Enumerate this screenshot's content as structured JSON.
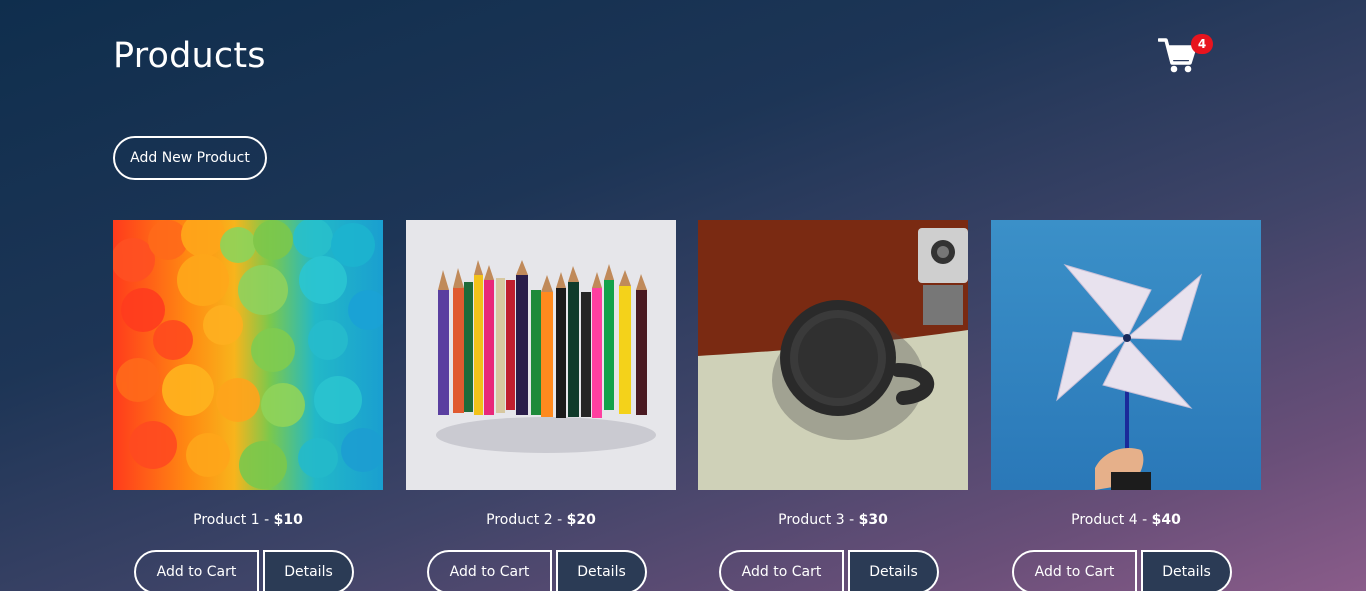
{
  "page": {
    "title": "Products"
  },
  "cart": {
    "icon": "cart-icon",
    "count": "4",
    "badge_color": "#e8141e"
  },
  "toolbar": {
    "add_new_label": "Add New Product"
  },
  "products": [
    {
      "name": "Product 1",
      "separator": " - ",
      "price": "$10",
      "add_to_cart_label": "Add to Cart",
      "details_label": "Details"
    },
    {
      "name": "Product 2",
      "separator": " - ",
      "price": "$20",
      "add_to_cart_label": "Add to Cart",
      "details_label": "Details"
    },
    {
      "name": "Product 3",
      "separator": " - ",
      "price": "$30",
      "add_to_cart_label": "Add to Cart",
      "details_label": "Details"
    },
    {
      "name": "Product 4",
      "separator": " - ",
      "price": "$40",
      "add_to_cart_label": "Add to Cart",
      "details_label": "Details"
    }
  ],
  "theme": {
    "background_start": "#0f2e4d",
    "background_end": "#8a5c8a",
    "details_button_bg": "#2b3b55"
  }
}
